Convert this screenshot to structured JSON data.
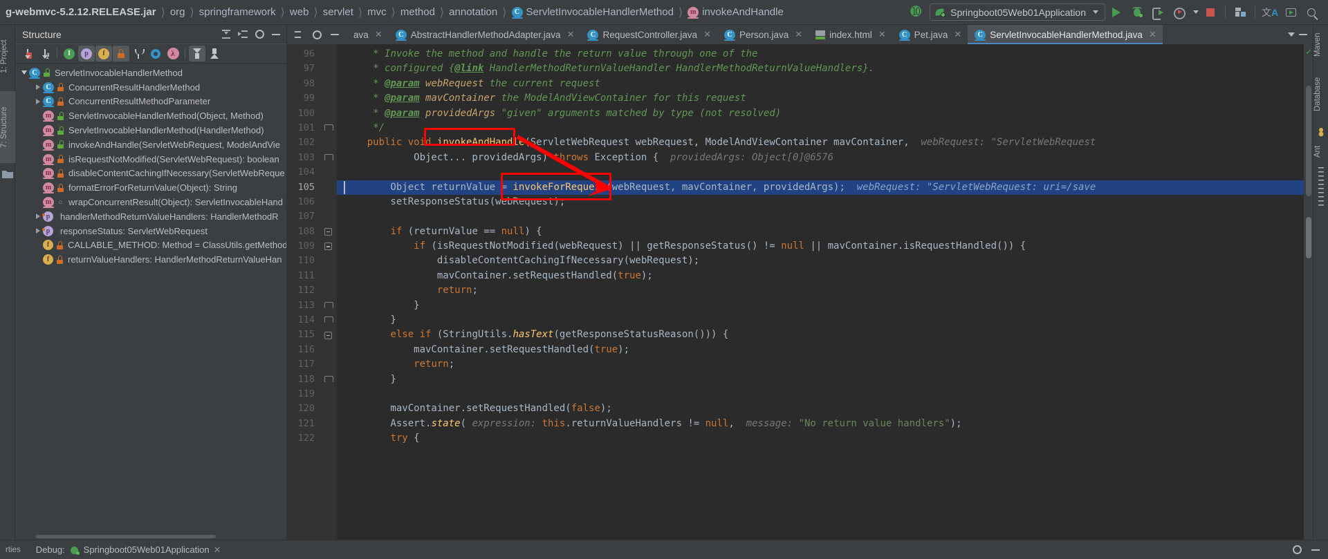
{
  "breadcrumb": {
    "items": [
      {
        "label": "g-webmvc-5.2.12.RELEASE.jar",
        "icon": "jar-icon"
      },
      {
        "label": "org",
        "icon": ""
      },
      {
        "label": "springframework",
        "icon": ""
      },
      {
        "label": "web",
        "icon": ""
      },
      {
        "label": "servlet",
        "icon": ""
      },
      {
        "label": "mvc",
        "icon": ""
      },
      {
        "label": "method",
        "icon": ""
      },
      {
        "label": "annotation",
        "icon": ""
      },
      {
        "label": "ServletInvocableHandlerMethod",
        "icon": "class-icon"
      },
      {
        "label": "invokeAndHandle",
        "icon": "method-icon"
      }
    ]
  },
  "toolbar": {
    "build_icon": "hammer-icon",
    "run_config": "Springboot05Web01Application",
    "run_icon": "run-icon",
    "debug_icon": "debug-icon",
    "coverage_icon": "run-with-coverage-icon",
    "profiler_icon": "profiler-icon",
    "stop_icon": "stop-icon",
    "modules_icon": "modules-icon",
    "translate_icon": "translate-icon",
    "terminal_icon": "terminal-icon",
    "search_icon": "search-everywhere-icon"
  },
  "left_rail": [
    {
      "label": "1: Project"
    },
    {
      "label": "7: Structure"
    }
  ],
  "right_rail": [
    {
      "label": "Maven"
    },
    {
      "label": "Database"
    },
    {
      "label": "Ant"
    }
  ],
  "structure": {
    "title": "Structure",
    "header_icons": [
      "expand-all-icon",
      "collapse-all-icon",
      "settings-icon",
      "hide-icon"
    ],
    "toolbar_icons": [
      {
        "name": "sort-by-visibility-icon",
        "active": false
      },
      {
        "name": "sort-alphabetically-icon",
        "active": false
      },
      {
        "name": "show-inherited-icon",
        "active": false
      },
      {
        "name": "show-properties-icon",
        "active": true
      },
      {
        "name": "show-fields-icon",
        "active": true
      },
      {
        "name": "show-non-public-icon",
        "active": true
      },
      {
        "name": "show-anonymous-icon",
        "active": false
      },
      {
        "name": "show-lambdas-icon",
        "active": false
      },
      {
        "name": "show-lambda-lambda-icon",
        "active": false
      },
      {
        "name": "scroll-from-source-icon",
        "active": true
      },
      {
        "name": "scroll-to-source-icon",
        "active": false
      }
    ],
    "tree": [
      {
        "label": "ServletInvocableHandlerMethod",
        "indent": 0,
        "arrow": "down",
        "icon": "class-icon",
        "badge": "public-lock"
      },
      {
        "label": "ConcurrentResultHandlerMethod",
        "indent": 1,
        "arrow": "right",
        "icon": "class-icon",
        "badge": "private-lock"
      },
      {
        "label": "ConcurrentResultMethodParameter",
        "indent": 1,
        "arrow": "right",
        "icon": "class-icon",
        "badge": "private-lock"
      },
      {
        "label": "ServletInvocableHandlerMethod(Object, Method)",
        "indent": 1,
        "arrow": "",
        "icon": "method-icon",
        "badge": "public-lock"
      },
      {
        "label": "ServletInvocableHandlerMethod(HandlerMethod)",
        "indent": 1,
        "arrow": "",
        "icon": "method-icon",
        "badge": "public-lock"
      },
      {
        "label": "invokeAndHandle(ServletWebRequest, ModelAndVie",
        "indent": 1,
        "arrow": "",
        "icon": "method-icon",
        "badge": "public-lock"
      },
      {
        "label": "isRequestNotModified(ServletWebRequest): boolean",
        "indent": 1,
        "arrow": "",
        "icon": "method-icon",
        "badge": "private-lock"
      },
      {
        "label": "disableContentCachingIfNecessary(ServletWebReque",
        "indent": 1,
        "arrow": "",
        "icon": "method-icon",
        "badge": "private-lock"
      },
      {
        "label": "formatErrorForReturnValue(Object): String",
        "indent": 1,
        "arrow": "",
        "icon": "method-icon",
        "badge": "private-lock"
      },
      {
        "label": "wrapConcurrentResult(Object): ServletInvocableHand",
        "indent": 1,
        "arrow": "",
        "icon": "method-icon",
        "badge": "package-dot"
      },
      {
        "label": "handlerMethodReturnValueHandlers: HandlerMethodR",
        "indent": 1,
        "arrow": "right",
        "icon": "property-icon",
        "badge": ""
      },
      {
        "label": "responseStatus: ServletWebRequest",
        "indent": 1,
        "arrow": "right",
        "icon": "property-icon",
        "badge": ""
      },
      {
        "label": "CALLABLE_METHOD: Method = ClassUtils.getMethod",
        "indent": 1,
        "arrow": "",
        "icon": "field-icon",
        "badge": "private-lock"
      },
      {
        "label": "returnValueHandlers: HandlerMethodReturnValueHan",
        "indent": 1,
        "arrow": "",
        "icon": "field-icon",
        "badge": "private-lock"
      }
    ]
  },
  "editor": {
    "tabs": [
      {
        "label": "ava",
        "icon": "java-class-icon",
        "active": false,
        "partial": true
      },
      {
        "label": "AbstractHandlerMethodAdapter.java",
        "icon": "java-class-icon",
        "active": false
      },
      {
        "label": "RequestController.java",
        "icon": "java-class-icon",
        "active": false
      },
      {
        "label": "Person.java",
        "icon": "java-class-icon",
        "active": false
      },
      {
        "label": "index.html",
        "icon": "html-file-icon",
        "active": false
      },
      {
        "label": "Pet.java",
        "icon": "java-class-icon",
        "active": false
      },
      {
        "label": "ServletInvocableHandlerMethod.java",
        "icon": "java-class-icon",
        "active": true
      }
    ],
    "first_line": 96,
    "highlighted_line": 105,
    "lines": [
      {
        "n": 96,
        "fold": "",
        "html": "     <span class='cmt'>* Invoke the method and handle the return value through one of the</span>"
      },
      {
        "n": 97,
        "fold": "",
        "html": "     <span class='cmt'>* configured {</span><span class='cmtlnk'>@link</span><span class='cmt'> </span><span class='cmt'>HandlerMethodReturnValueHandler</span><span class='cmt'> HandlerMethodReturnValueHandlers}.</span>"
      },
      {
        "n": 98,
        "fold": "",
        "html": "     <span class='cmt'>* </span><span class='tag'>@param</span><span class='cmt'> </span><span class='pname'>webRequest</span><span class='cmt'> the current request</span>"
      },
      {
        "n": 99,
        "fold": "",
        "html": "     <span class='cmt'>* </span><span class='tag'>@param</span><span class='cmt'> </span><span class='pname'>mavContainer</span><span class='cmt'> the ModelAndViewContainer for this request</span>"
      },
      {
        "n": 100,
        "fold": "",
        "html": "     <span class='cmt'>* </span><span class='tag'>@param</span><span class='cmt'> </span><span class='pname'>providedArgs</span><span class='cmt'> \"given\" arguments matched by type (not resolved)</span>"
      },
      {
        "n": 101,
        "fold": "end",
        "html": "     <span class='cmt'>*/</span>"
      },
      {
        "n": 102,
        "fold": "",
        "html": "    <span class='kw'>public</span> <span class='kw'>void</span> <span class='mth'>invokeAndHandle</span>(ServletWebRequest webRequest, ModelAndViewContainer mavContainer,  <span class='hint'>webRequest: \"ServletWebRequest</span>"
      },
      {
        "n": 103,
        "fold": "end",
        "html": "            Object... providedArgs) <span class='kw'>throws</span> Exception {  <span class='hint'>providedArgs: Object[0]@6576</span>"
      },
      {
        "n": 104,
        "fold": "",
        "html": ""
      },
      {
        "n": 105,
        "fold": "",
        "hl": true,
        "html": "        Object returnValue = <span class='mth'>invokeForRequest</span>(webRequest, mavContainer, providedArgs);  <span class='hlhint'>webRequest: \"ServletWebRequest: uri=/save</span>"
      },
      {
        "n": 106,
        "fold": "",
        "html": "        setResponseStatus(webRequest);"
      },
      {
        "n": 107,
        "fold": "",
        "html": ""
      },
      {
        "n": 108,
        "fold": "start",
        "html": "        <span class='kw'>if</span> (returnValue == <span class='kw'>null</span>) {"
      },
      {
        "n": 109,
        "fold": "start",
        "html": "            <span class='kw'>if</span> (isRequestNotModified(webRequest) || getResponseStatus() != <span class='kw'>null</span> || mavContainer.isRequestHandled()) {"
      },
      {
        "n": 110,
        "fold": "",
        "html": "                disableContentCachingIfNecessary(webRequest);"
      },
      {
        "n": 111,
        "fold": "",
        "html": "                mavContainer.setRequestHandled(<span class='kw'>true</span>);"
      },
      {
        "n": 112,
        "fold": "",
        "html": "                <span class='kw'>return</span>;"
      },
      {
        "n": 113,
        "fold": "end",
        "html": "            }"
      },
      {
        "n": 114,
        "fold": "end",
        "html": "        }"
      },
      {
        "n": 115,
        "fold": "start",
        "html": "        <span class='kw'>else if</span> (StringUtils.<span class='mth' style='font-style:italic'>hasText</span>(getResponseStatusReason())) {"
      },
      {
        "n": 116,
        "fold": "",
        "html": "            mavContainer.setRequestHandled(<span class='kw'>true</span>);"
      },
      {
        "n": 117,
        "fold": "",
        "html": "            <span class='kw'>return</span>;"
      },
      {
        "n": 118,
        "fold": "end",
        "html": "        }"
      },
      {
        "n": 119,
        "fold": "",
        "html": ""
      },
      {
        "n": 120,
        "fold": "",
        "html": "        mavContainer.setRequestHandled(<span class='kw'>false</span>);"
      },
      {
        "n": 121,
        "fold": "",
        "html": "        Assert.<span class='mth' style='font-style:italic'>state</span>( <span class='hint'>expression:</span> <span class='kw'>this</span>.returnValueHandlers != <span class='kw'>null</span>,  <span class='hint'>message:</span> <span class='str'>\"No return value handlers\"</span>);"
      },
      {
        "n": 122,
        "fold": "",
        "html": "        <span class='kw'>try</span> {"
      }
    ]
  },
  "annotations": {
    "box1_label": "invokeAndHandle-highlight-box",
    "box2_label": "invokeForRequest-highlight-box",
    "arrow_label": "red-arrow-annotation",
    "color": "#ff0000"
  },
  "bottom": {
    "debug_label": "Debug:",
    "session": "Springboot05Web01Application",
    "close_icon": "close-icon",
    "settings_icon": "settings-icon",
    "minimize_icon": "minimize-icon",
    "left_tab": "rties"
  }
}
